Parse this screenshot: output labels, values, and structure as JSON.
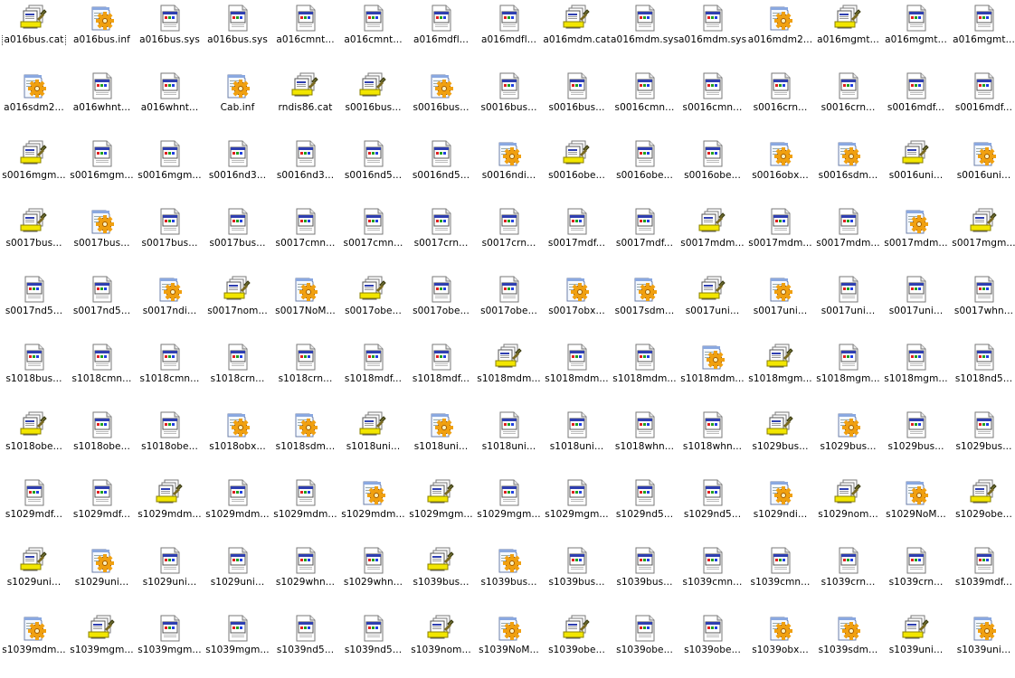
{
  "folder_view": {
    "focused_index": 0,
    "items": [
      {
        "name": "a016bus.cat",
        "icon": "catalog-file-icon"
      },
      {
        "name": "a016bus.inf",
        "icon": "setup-info-file-icon"
      },
      {
        "name": "a016bus.sys",
        "icon": "system-file-icon"
      },
      {
        "name": "a016bus.sys",
        "icon": "system-file-icon"
      },
      {
        "name": "a016cmnt...",
        "icon": "system-file-icon"
      },
      {
        "name": "a016cmnt...",
        "icon": "system-file-icon"
      },
      {
        "name": "a016mdfl...",
        "icon": "system-file-icon"
      },
      {
        "name": "a016mdfl...",
        "icon": "system-file-icon"
      },
      {
        "name": "a016mdm.cat",
        "icon": "catalog-file-icon"
      },
      {
        "name": "a016mdm.sys",
        "icon": "system-file-icon"
      },
      {
        "name": "a016mdm.sys",
        "icon": "system-file-icon"
      },
      {
        "name": "a016mdm2...",
        "icon": "setup-info-file-icon"
      },
      {
        "name": "a016mgmt...",
        "icon": "catalog-file-icon"
      },
      {
        "name": "a016mgmt...",
        "icon": "system-file-icon"
      },
      {
        "name": "a016mgmt...",
        "icon": "system-file-icon"
      },
      {
        "name": "a016sdm2...",
        "icon": "setup-info-file-icon"
      },
      {
        "name": "a016whnt...",
        "icon": "system-file-icon"
      },
      {
        "name": "a016whnt...",
        "icon": "system-file-icon"
      },
      {
        "name": "Cab.inf",
        "icon": "setup-info-file-icon"
      },
      {
        "name": "rndis86.cat",
        "icon": "catalog-file-icon"
      },
      {
        "name": "s0016bus...",
        "icon": "catalog-file-icon"
      },
      {
        "name": "s0016bus...",
        "icon": "setup-info-file-icon"
      },
      {
        "name": "s0016bus...",
        "icon": "system-file-icon"
      },
      {
        "name": "s0016bus...",
        "icon": "system-file-icon"
      },
      {
        "name": "s0016cmn...",
        "icon": "system-file-icon"
      },
      {
        "name": "s0016cmn...",
        "icon": "system-file-icon"
      },
      {
        "name": "s0016crn...",
        "icon": "system-file-icon"
      },
      {
        "name": "s0016crn...",
        "icon": "system-file-icon"
      },
      {
        "name": "s0016mdf...",
        "icon": "system-file-icon"
      },
      {
        "name": "s0016mdf...",
        "icon": "system-file-icon"
      },
      {
        "name": "s0016mgm...",
        "icon": "catalog-file-icon"
      },
      {
        "name": "s0016mgm...",
        "icon": "system-file-icon"
      },
      {
        "name": "s0016mgm...",
        "icon": "system-file-icon"
      },
      {
        "name": "s0016nd3...",
        "icon": "system-file-icon"
      },
      {
        "name": "s0016nd3...",
        "icon": "system-file-icon"
      },
      {
        "name": "s0016nd5...",
        "icon": "system-file-icon"
      },
      {
        "name": "s0016nd5...",
        "icon": "system-file-icon"
      },
      {
        "name": "s0016ndi...",
        "icon": "setup-info-file-icon"
      },
      {
        "name": "s0016obe...",
        "icon": "catalog-file-icon"
      },
      {
        "name": "s0016obe...",
        "icon": "system-file-icon"
      },
      {
        "name": "s0016obe...",
        "icon": "system-file-icon"
      },
      {
        "name": "s0016obx...",
        "icon": "setup-info-file-icon"
      },
      {
        "name": "s0016sdm...",
        "icon": "setup-info-file-icon"
      },
      {
        "name": "s0016uni...",
        "icon": "catalog-file-icon"
      },
      {
        "name": "s0016uni...",
        "icon": "setup-info-file-icon"
      },
      {
        "name": "s0017bus...",
        "icon": "catalog-file-icon"
      },
      {
        "name": "s0017bus...",
        "icon": "setup-info-file-icon"
      },
      {
        "name": "s0017bus...",
        "icon": "system-file-icon"
      },
      {
        "name": "s0017bus...",
        "icon": "system-file-icon"
      },
      {
        "name": "s0017cmn...",
        "icon": "system-file-icon"
      },
      {
        "name": "s0017cmn...",
        "icon": "system-file-icon"
      },
      {
        "name": "s0017crn...",
        "icon": "system-file-icon"
      },
      {
        "name": "s0017crn...",
        "icon": "system-file-icon"
      },
      {
        "name": "s0017mdf...",
        "icon": "system-file-icon"
      },
      {
        "name": "s0017mdf...",
        "icon": "system-file-icon"
      },
      {
        "name": "s0017mdm...",
        "icon": "catalog-file-icon"
      },
      {
        "name": "s0017mdm...",
        "icon": "system-file-icon"
      },
      {
        "name": "s0017mdm...",
        "icon": "system-file-icon"
      },
      {
        "name": "s0017mdm...",
        "icon": "setup-info-file-icon"
      },
      {
        "name": "s0017mgm...",
        "icon": "catalog-file-icon"
      },
      {
        "name": "s0017nd5...",
        "icon": "system-file-icon"
      },
      {
        "name": "s0017nd5...",
        "icon": "system-file-icon"
      },
      {
        "name": "s0017ndi...",
        "icon": "setup-info-file-icon"
      },
      {
        "name": "s0017nom...",
        "icon": "catalog-file-icon"
      },
      {
        "name": "s0017NoM...",
        "icon": "setup-info-file-icon"
      },
      {
        "name": "s0017obe...",
        "icon": "catalog-file-icon"
      },
      {
        "name": "s0017obe...",
        "icon": "system-file-icon"
      },
      {
        "name": "s0017obe...",
        "icon": "system-file-icon"
      },
      {
        "name": "s0017obx...",
        "icon": "setup-info-file-icon"
      },
      {
        "name": "s0017sdm...",
        "icon": "setup-info-file-icon"
      },
      {
        "name": "s0017uni...",
        "icon": "catalog-file-icon"
      },
      {
        "name": "s0017uni...",
        "icon": "setup-info-file-icon"
      },
      {
        "name": "s0017uni...",
        "icon": "system-file-icon"
      },
      {
        "name": "s0017uni...",
        "icon": "system-file-icon"
      },
      {
        "name": "s0017whn...",
        "icon": "system-file-icon"
      },
      {
        "name": "s1018bus...",
        "icon": "system-file-icon"
      },
      {
        "name": "s1018cmn...",
        "icon": "system-file-icon"
      },
      {
        "name": "s1018cmn...",
        "icon": "system-file-icon"
      },
      {
        "name": "s1018crn...",
        "icon": "system-file-icon"
      },
      {
        "name": "s1018crn...",
        "icon": "system-file-icon"
      },
      {
        "name": "s1018mdf...",
        "icon": "system-file-icon"
      },
      {
        "name": "s1018mdf...",
        "icon": "system-file-icon"
      },
      {
        "name": "s1018mdm...",
        "icon": "catalog-file-icon"
      },
      {
        "name": "s1018mdm...",
        "icon": "system-file-icon"
      },
      {
        "name": "s1018mdm...",
        "icon": "system-file-icon"
      },
      {
        "name": "s1018mdm...",
        "icon": "setup-info-file-icon"
      },
      {
        "name": "s1018mgm...",
        "icon": "catalog-file-icon"
      },
      {
        "name": "s1018mgm...",
        "icon": "system-file-icon"
      },
      {
        "name": "s1018mgm...",
        "icon": "system-file-icon"
      },
      {
        "name": "s1018nd5...",
        "icon": "system-file-icon"
      },
      {
        "name": "s1018obe...",
        "icon": "catalog-file-icon"
      },
      {
        "name": "s1018obe...",
        "icon": "system-file-icon"
      },
      {
        "name": "s1018obe...",
        "icon": "system-file-icon"
      },
      {
        "name": "s1018obx...",
        "icon": "setup-info-file-icon"
      },
      {
        "name": "s1018sdm...",
        "icon": "setup-info-file-icon"
      },
      {
        "name": "s1018uni...",
        "icon": "catalog-file-icon"
      },
      {
        "name": "s1018uni...",
        "icon": "setup-info-file-icon"
      },
      {
        "name": "s1018uni...",
        "icon": "system-file-icon"
      },
      {
        "name": "s1018uni...",
        "icon": "system-file-icon"
      },
      {
        "name": "s1018whn...",
        "icon": "system-file-icon"
      },
      {
        "name": "s1018whn...",
        "icon": "system-file-icon"
      },
      {
        "name": "s1029bus...",
        "icon": "catalog-file-icon"
      },
      {
        "name": "s1029bus...",
        "icon": "setup-info-file-icon"
      },
      {
        "name": "s1029bus...",
        "icon": "system-file-icon"
      },
      {
        "name": "s1029bus...",
        "icon": "system-file-icon"
      },
      {
        "name": "s1029mdf...",
        "icon": "system-file-icon"
      },
      {
        "name": "s1029mdf...",
        "icon": "system-file-icon"
      },
      {
        "name": "s1029mdm...",
        "icon": "catalog-file-icon"
      },
      {
        "name": "s1029mdm...",
        "icon": "system-file-icon"
      },
      {
        "name": "s1029mdm...",
        "icon": "system-file-icon"
      },
      {
        "name": "s1029mdm...",
        "icon": "setup-info-file-icon"
      },
      {
        "name": "s1029mgm...",
        "icon": "catalog-file-icon"
      },
      {
        "name": "s1029mgm...",
        "icon": "system-file-icon"
      },
      {
        "name": "s1029mgm...",
        "icon": "system-file-icon"
      },
      {
        "name": "s1029nd5...",
        "icon": "system-file-icon"
      },
      {
        "name": "s1029nd5...",
        "icon": "system-file-icon"
      },
      {
        "name": "s1029ndi...",
        "icon": "setup-info-file-icon"
      },
      {
        "name": "s1029nom...",
        "icon": "catalog-file-icon"
      },
      {
        "name": "s1029NoM...",
        "icon": "setup-info-file-icon"
      },
      {
        "name": "s1029obe...",
        "icon": "catalog-file-icon"
      },
      {
        "name": "s1029uni...",
        "icon": "catalog-file-icon"
      },
      {
        "name": "s1029uni...",
        "icon": "setup-info-file-icon"
      },
      {
        "name": "s1029uni...",
        "icon": "system-file-icon"
      },
      {
        "name": "s1029uni...",
        "icon": "system-file-icon"
      },
      {
        "name": "s1029whn...",
        "icon": "system-file-icon"
      },
      {
        "name": "s1029whn...",
        "icon": "system-file-icon"
      },
      {
        "name": "s1039bus...",
        "icon": "catalog-file-icon"
      },
      {
        "name": "s1039bus...",
        "icon": "setup-info-file-icon"
      },
      {
        "name": "s1039bus...",
        "icon": "system-file-icon"
      },
      {
        "name": "s1039bus...",
        "icon": "system-file-icon"
      },
      {
        "name": "s1039cmn...",
        "icon": "system-file-icon"
      },
      {
        "name": "s1039cmn...",
        "icon": "system-file-icon"
      },
      {
        "name": "s1039crn...",
        "icon": "system-file-icon"
      },
      {
        "name": "s1039crn...",
        "icon": "system-file-icon"
      },
      {
        "name": "s1039mdf...",
        "icon": "system-file-icon"
      },
      {
        "name": "s1039mdm...",
        "icon": "setup-info-file-icon"
      },
      {
        "name": "s1039mgm...",
        "icon": "catalog-file-icon"
      },
      {
        "name": "s1039mgm...",
        "icon": "system-file-icon"
      },
      {
        "name": "s1039mgm...",
        "icon": "system-file-icon"
      },
      {
        "name": "s1039nd5...",
        "icon": "system-file-icon"
      },
      {
        "name": "s1039nd5...",
        "icon": "system-file-icon"
      },
      {
        "name": "s1039nom...",
        "icon": "catalog-file-icon"
      },
      {
        "name": "s1039NoM...",
        "icon": "setup-info-file-icon"
      },
      {
        "name": "s1039obe...",
        "icon": "catalog-file-icon"
      },
      {
        "name": "s1039obe...",
        "icon": "system-file-icon"
      },
      {
        "name": "s1039obe...",
        "icon": "system-file-icon"
      },
      {
        "name": "s1039obx...",
        "icon": "setup-info-file-icon"
      },
      {
        "name": "s1039sdm...",
        "icon": "setup-info-file-icon"
      },
      {
        "name": "s1039uni...",
        "icon": "catalog-file-icon"
      },
      {
        "name": "s1039uni...",
        "icon": "setup-info-file-icon"
      }
    ]
  },
  "icon_colors": {
    "page_border": "#7a7a7a",
    "title_bar": "#2f3fb0",
    "catalog_band": "#f2e600",
    "gear": "#f0a010"
  }
}
